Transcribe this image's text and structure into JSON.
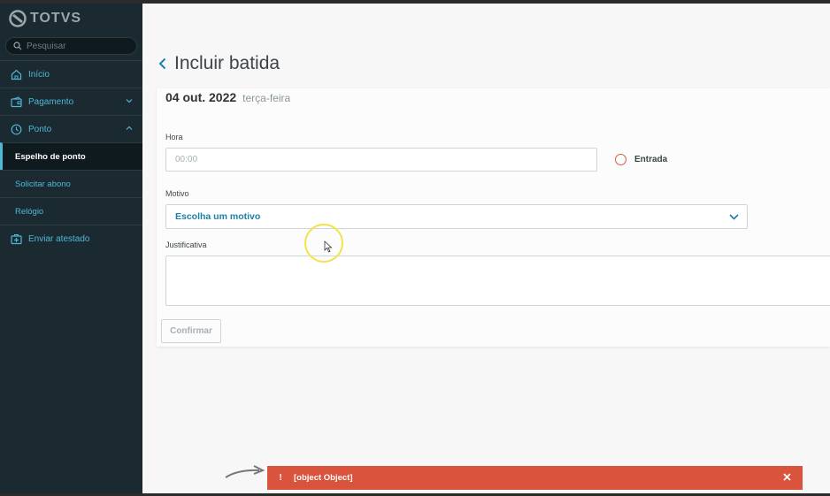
{
  "app": {
    "logo_text": "TOTVS"
  },
  "sidebar": {
    "search_placeholder": "Pesquisar",
    "items": [
      {
        "label": "Início",
        "icon": "home-icon"
      },
      {
        "label": "Pagamento",
        "icon": "wallet-icon"
      },
      {
        "label": "Ponto",
        "icon": "clock-icon"
      }
    ],
    "sub_items": [
      {
        "label": "Espelho de ponto",
        "active": true
      },
      {
        "label": "Solicitar abono",
        "active": false
      },
      {
        "label": "Relógio",
        "active": false
      }
    ],
    "extra_item": {
      "label": "Enviar atestado",
      "icon": "medical-icon"
    }
  },
  "page": {
    "title": "Incluir batida",
    "date_main": "04 out. 2022",
    "date_sub": "terça-feira"
  },
  "form": {
    "hora_label": "Hora",
    "hora_placeholder": "00:00",
    "radio_label": "Entrada",
    "motivo_label": "Motivo",
    "motivo_value": "Escolha um motivo",
    "justificativa_label": "Justificativa",
    "confirm_label": "Confirmar"
  },
  "toast": {
    "icon": "!",
    "message": "[object Object]"
  },
  "colors": {
    "accent": "#4fb7d8",
    "sidebar_bg": "#1b2a30",
    "toast_bg": "#d9533d"
  }
}
